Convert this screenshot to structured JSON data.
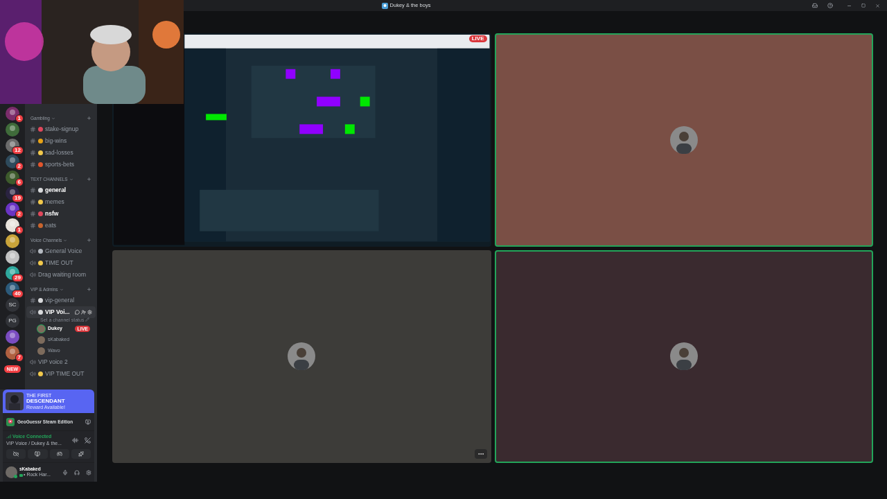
{
  "window": {
    "title": "Dukey & the boys"
  },
  "servers": [
    {
      "kind": "icon",
      "badge": "1"
    },
    {
      "kind": "icon"
    },
    {
      "kind": "icon",
      "badge": "12"
    },
    {
      "kind": "icon",
      "badge": "2"
    },
    {
      "kind": "icon",
      "badge": "6"
    },
    {
      "kind": "icon",
      "badge": "19"
    },
    {
      "kind": "icon",
      "badge": "2"
    },
    {
      "kind": "icon",
      "badge": "1"
    },
    {
      "kind": "icon"
    },
    {
      "kind": "icon"
    },
    {
      "kind": "icon",
      "badge": "29"
    },
    {
      "kind": "icon",
      "badge": "40"
    },
    {
      "kind": "label",
      "label": "SC"
    },
    {
      "kind": "label",
      "label": "PG"
    },
    {
      "kind": "icon"
    },
    {
      "kind": "icon",
      "badge": "7"
    },
    {
      "kind": "new",
      "label": "NEW"
    }
  ],
  "categories": [
    {
      "name": "Gambling",
      "channels": [
        {
          "kind": "text",
          "name": "stake-signup",
          "color": "#e0475b",
          "unread": false
        },
        {
          "kind": "text",
          "name": "big-wins",
          "color": "#e8a317",
          "unread": false
        },
        {
          "kind": "text",
          "name": "sad-losses",
          "color": "#f2c94c",
          "unread": false
        },
        {
          "kind": "text",
          "name": "sports-bets",
          "color": "#e2552c",
          "unread": false
        }
      ]
    },
    {
      "name": "TEXT CHANNELS",
      "channels": [
        {
          "kind": "text",
          "name": "general",
          "color": "#d9dadc",
          "unread": true
        },
        {
          "kind": "text",
          "name": "memes",
          "color": "#f2c94c",
          "unread": false
        },
        {
          "kind": "text",
          "name": "nsfw",
          "color": "#e0475b",
          "unread": true
        },
        {
          "kind": "text",
          "name": "eats",
          "color": "#c8642d",
          "unread": false
        }
      ]
    },
    {
      "name": "Voice Channels",
      "channels": [
        {
          "kind": "voice",
          "name": "General Voice",
          "color": "#b5bac1",
          "selected": false
        },
        {
          "kind": "voice",
          "name": "TIME OUT",
          "color": "#f2c94c",
          "selected": false
        },
        {
          "kind": "voice",
          "name": "Drag waiting room",
          "selected": false
        }
      ]
    },
    {
      "name": "VIP & Admins",
      "channels": [
        {
          "kind": "text",
          "name": "vip-general",
          "color": "#d9dadc",
          "unread": false
        },
        {
          "kind": "voice",
          "name": "VIP Voi...",
          "color": "#d9dadc",
          "selected": true,
          "status": "Set a channel status",
          "users": [
            {
              "name": "Dukey",
              "badge": "LIVE",
              "speaking": true
            },
            {
              "name": "sKabaked",
              "speaking": false
            },
            {
              "name": "Wavo",
              "speaking": false
            }
          ]
        },
        {
          "kind": "voice",
          "name": "VIP voice 2",
          "selected": false
        },
        {
          "kind": "voice",
          "name": "VIP TIME OUT",
          "color": "#f2c94c",
          "selected": false
        }
      ]
    }
  ],
  "promo": {
    "overline": "THE FIRST",
    "title": "DESCENDANT",
    "subtitle": "Reward Available!"
  },
  "activity": {
    "name": "GeoGuessr Steam Edition"
  },
  "voice": {
    "status": "Voice Connected",
    "channel": "VIP Voice / Dukey & the..."
  },
  "user": {
    "name": "sKabaked",
    "status": "• Rock Har..."
  },
  "tiles": [
    {
      "kind": "stream",
      "live_badge": "LIVE",
      "speaking": false
    },
    {
      "kind": "avatar",
      "speaking": true,
      "color": "#7a4f45"
    },
    {
      "kind": "avatar",
      "speaking": false,
      "color": "#3d3c39"
    },
    {
      "kind": "avatar",
      "speaking": true,
      "color": "#3a2a2f"
    }
  ]
}
